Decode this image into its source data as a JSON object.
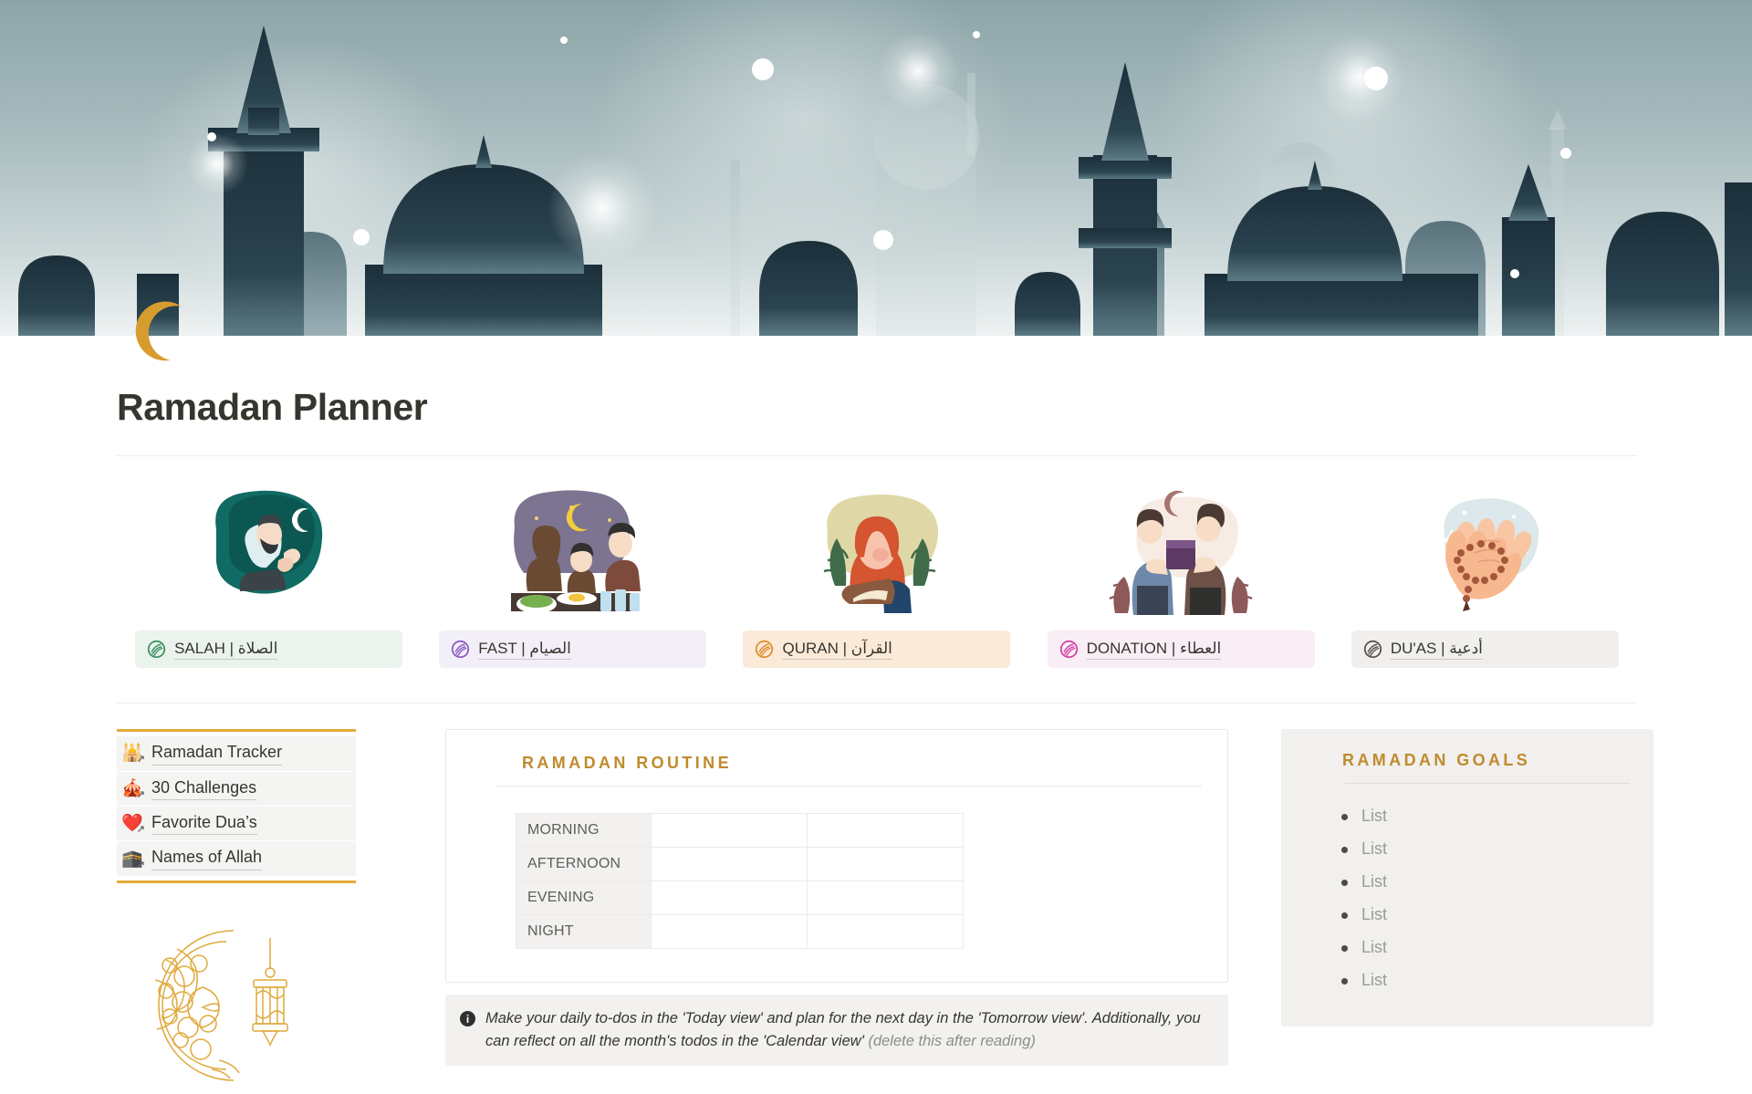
{
  "header": {
    "page_icon": "crescent-moon-icon",
    "banner_alt": "mosque-skyline-silhouette-banner",
    "title": "Ramadan Planner"
  },
  "cards": [
    {
      "illustration": "man-praying-illustration",
      "label_en": "SALAH",
      "label_ar": "الصلاة",
      "separator": "|",
      "icon": "swirl-circle-icon",
      "icon_color": "#3a8f5f",
      "bg_color": "#eaf3ec"
    },
    {
      "illustration": "family-iftar-illustration",
      "label_en": "FAST",
      "label_ar": "الصيام",
      "separator": "|",
      "icon": "swirl-circle-icon",
      "icon_color": "#8a56c4",
      "bg_color": "#f3eff8"
    },
    {
      "illustration": "woman-reading-quran-illustration",
      "label_en": "QURAN",
      "label_ar": "القرآن",
      "separator": "|",
      "icon": "swirl-circle-icon",
      "icon_color": "#e08a26",
      "bg_color": "#fbead8"
    },
    {
      "illustration": "charity-giving-illustration",
      "label_en": "DONATION",
      "label_ar": "العطاء",
      "separator": "|",
      "icon": "swirl-circle-icon",
      "icon_color": "#cf3fa0",
      "bg_color": "#f9eef5"
    },
    {
      "illustration": "praying-hands-tasbih-illustration",
      "label_en": "DU'AS",
      "label_ar": "أدعية",
      "separator": "|",
      "icon": "swirl-circle-icon",
      "icon_color": "#54514d",
      "bg_color": "#f0efee"
    }
  ],
  "sidebar": {
    "accent_color": "#e3ab38",
    "items": [
      {
        "emoji": "🕌",
        "label": "Ramadan Tracker",
        "icon": "mosque-emoji-icon"
      },
      {
        "emoji": "🎪",
        "label": "30 Challenges",
        "icon": "challenges-emoji-icon"
      },
      {
        "emoji": "❤️",
        "label": "Favorite Dua’s",
        "icon": "heart-emoji-icon"
      },
      {
        "emoji": "🕋",
        "label": "Names of Allah",
        "icon": "names-emoji-icon"
      }
    ],
    "decoration": "ornate-crescent-lantern-illustration"
  },
  "routine": {
    "icon": "crescent-moon-icon",
    "title": "RAMADAN ROUTINE",
    "accent_color": "#c08b2d",
    "rows": [
      {
        "label": "MORNING",
        "cell_a": "",
        "cell_b": ""
      },
      {
        "label": "AFTERNOON",
        "cell_a": "",
        "cell_b": ""
      },
      {
        "label": "EVENING",
        "cell_a": "",
        "cell_b": ""
      },
      {
        "label": "NIGHT",
        "cell_a": "",
        "cell_b": ""
      }
    ]
  },
  "callout": {
    "icon": "info-icon",
    "text": "Make your daily to-dos in the 'Today view' and plan for the next day in the 'Tomorrow view'. Additionally, you can reflect on all the month's todos in the 'Calendar view'",
    "dim_text": " (delete this after reading)"
  },
  "goals": {
    "icon": "crescent-moon-icon",
    "title": "RAMADAN GOALS",
    "accent_color": "#c08b2d",
    "items": [
      "List",
      "List",
      "List",
      "List",
      "List",
      "List"
    ]
  }
}
